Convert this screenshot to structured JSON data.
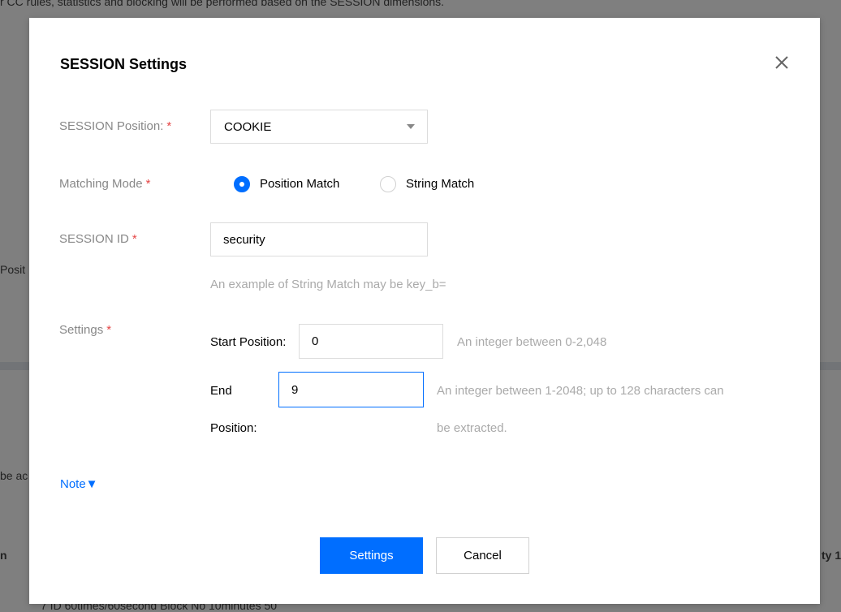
{
  "background": {
    "top_text": "r CC rules, statistics and blocking will be performed based on the SESSION dimensions.",
    "left_fragment_1": "Posit",
    "left_fragment_2": "be ac",
    "left_fragment_3": "n",
    "right_fragment": "ty 1",
    "row_fragment": "7 ID          60times/60second          Block          No          10minutes   50"
  },
  "dialog": {
    "title": "SESSION Settings",
    "close_icon": "close-icon",
    "position": {
      "label": "SESSION Position:",
      "required": "*",
      "value": "COOKIE"
    },
    "matching_mode": {
      "label": "Matching Mode",
      "required": "*",
      "options": [
        {
          "label": "Position Match",
          "selected": true
        },
        {
          "label": "String Match",
          "selected": false
        }
      ]
    },
    "session_id": {
      "label": "SESSION ID",
      "required": "*",
      "value": "security",
      "hint": "An example of String Match may be key_b="
    },
    "settings": {
      "label": "Settings",
      "required": "*",
      "start_label": "Start Position:",
      "start_value": "0",
      "start_hint": "An integer between 0-2,048",
      "end_label_line1": "End",
      "end_label_line2": "Position:",
      "end_value": "9",
      "end_hint_line1": "An integer between 1-2048; up to 128 characters can",
      "end_hint_line2": "be extracted."
    },
    "note_link": "Note▼",
    "buttons": {
      "confirm": "Settings",
      "cancel": "Cancel"
    }
  },
  "colors": {
    "primary": "#006eff",
    "required": "#e54545",
    "hint": "#aaaaaa"
  }
}
